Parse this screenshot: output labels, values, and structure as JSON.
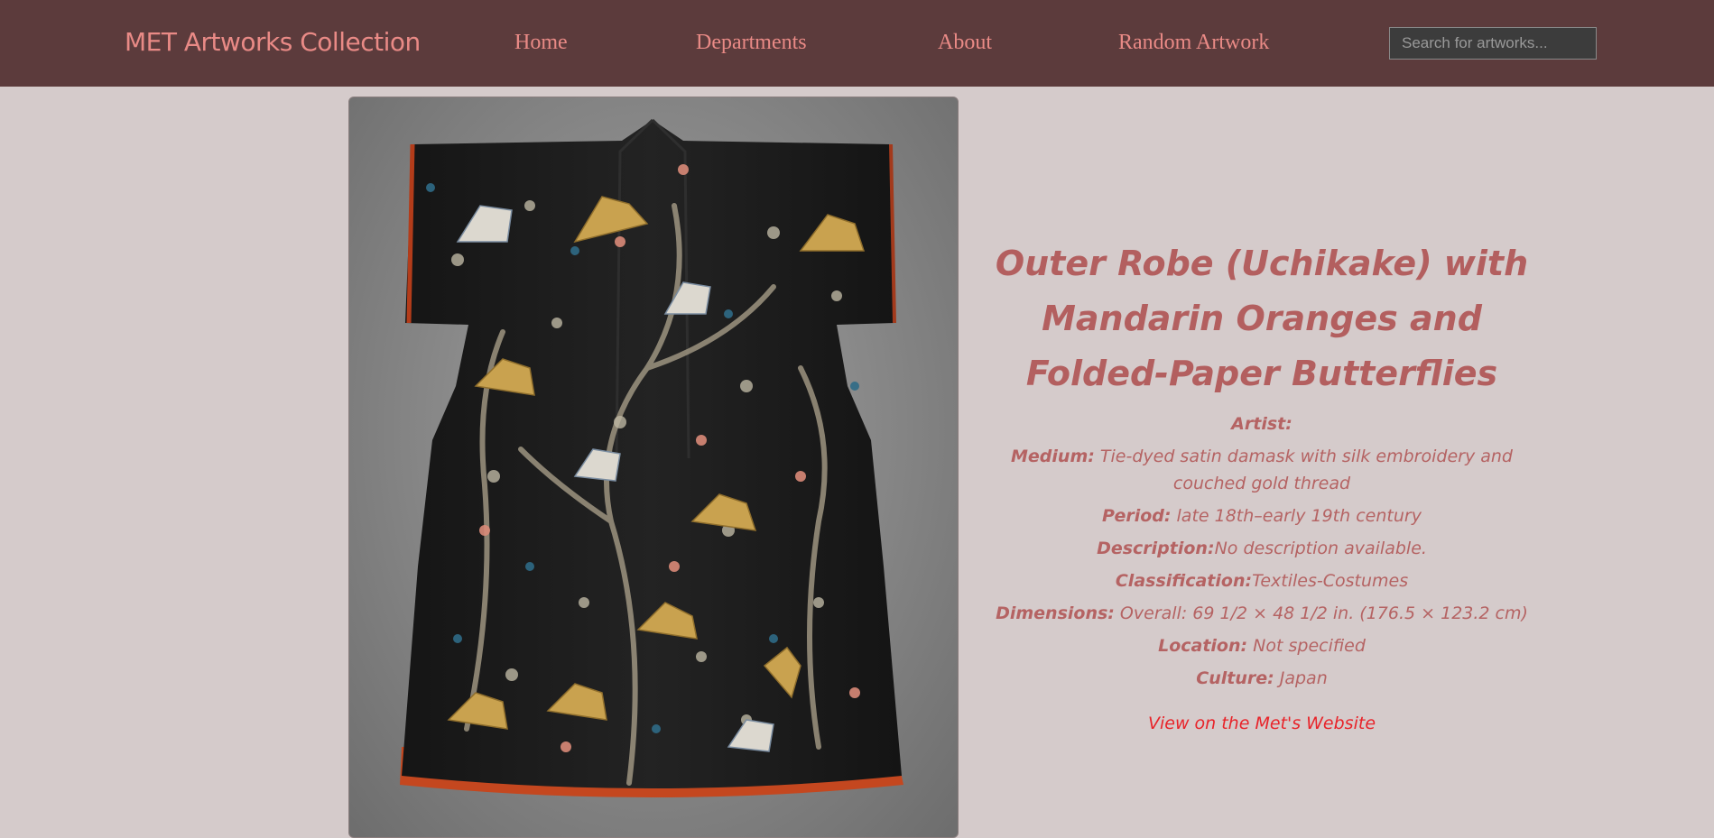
{
  "header": {
    "brand": "MET Artworks Collection",
    "nav": [
      "Home",
      "Departments",
      "About",
      "Random Artwork"
    ],
    "search_placeholder": "Search for artworks..."
  },
  "artwork": {
    "image_alt": "Outer Robe (Uchikake) with Mandarin Oranges and Folded-Paper Butterflies",
    "title": "Outer Robe (Uchikake) with Mandarin Oranges and Folded-Paper Butterflies",
    "fields": [
      {
        "label": "Artist:",
        "value": ""
      },
      {
        "label": "Medium:",
        "value": " Tie-dyed satin damask with silk embroidery and couched gold thread"
      },
      {
        "label": "Period:",
        "value": " late 18th–early 19th century"
      },
      {
        "label": "Description:",
        "value": "No description available."
      },
      {
        "label": "Classification:",
        "value": "Textiles-Costumes"
      },
      {
        "label": "Dimensions:",
        "value": " Overall: 69 1/2 × 48 1/2 in. (176.5 × 123.2 cm)"
      },
      {
        "label": "Location:",
        "value": " Not specified"
      },
      {
        "label": "Culture:",
        "value": " Japan"
      }
    ],
    "link_text": "View on the Met's Website"
  },
  "colors": {
    "header_bg": "#5c3b3c",
    "page_bg": "#d5cbcb",
    "accent": "#e98a86",
    "text": "#b56363",
    "link": "#e8242a"
  }
}
